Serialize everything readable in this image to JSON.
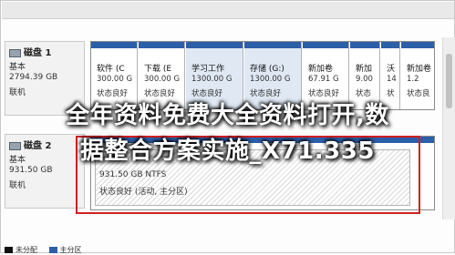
{
  "disk1": {
    "name": "磁盘 1",
    "type": "基本",
    "size": "2794.39 GB",
    "status": "联机",
    "partitions": [
      {
        "name": "软件 (C",
        "size": "300.00 G",
        "status": "状态良好"
      },
      {
        "name": "下载 (E",
        "size": "300.00 G",
        "status": "状态良好"
      },
      {
        "name": "学习工作",
        "size": "1300.00 G",
        "status": "状态良好"
      },
      {
        "name": "存储 (G:)",
        "size": "1300.00 G",
        "status": "状态良好"
      },
      {
        "name": "新加卷",
        "size": "67.91 G",
        "status": "状态良好"
      },
      {
        "name": "新加",
        "size": "9.00",
        "status": "状态"
      },
      {
        "name": "沃",
        "size": "14",
        "status": "状"
      },
      {
        "name": "新加卷",
        "size": "1.2",
        "status": "状态良"
      }
    ]
  },
  "disk2": {
    "name": "磁盘 2",
    "type": "基本",
    "size": "931.50 GB",
    "status": "联机",
    "partition": {
      "size": "931.50 GB NTFS",
      "status": "状态良好 (活动, 主分区)"
    }
  },
  "legend": {
    "unallocated": "未分配",
    "primary": "主分区"
  },
  "overlay": {
    "line1": "全年资料免费大全资料打开,数",
    "line2": "据整合方案实施_X71.335"
  },
  "colors": {
    "partition_bar": "#2d5ea8",
    "highlight_box": "#d02020",
    "unallocated": "#111111"
  }
}
